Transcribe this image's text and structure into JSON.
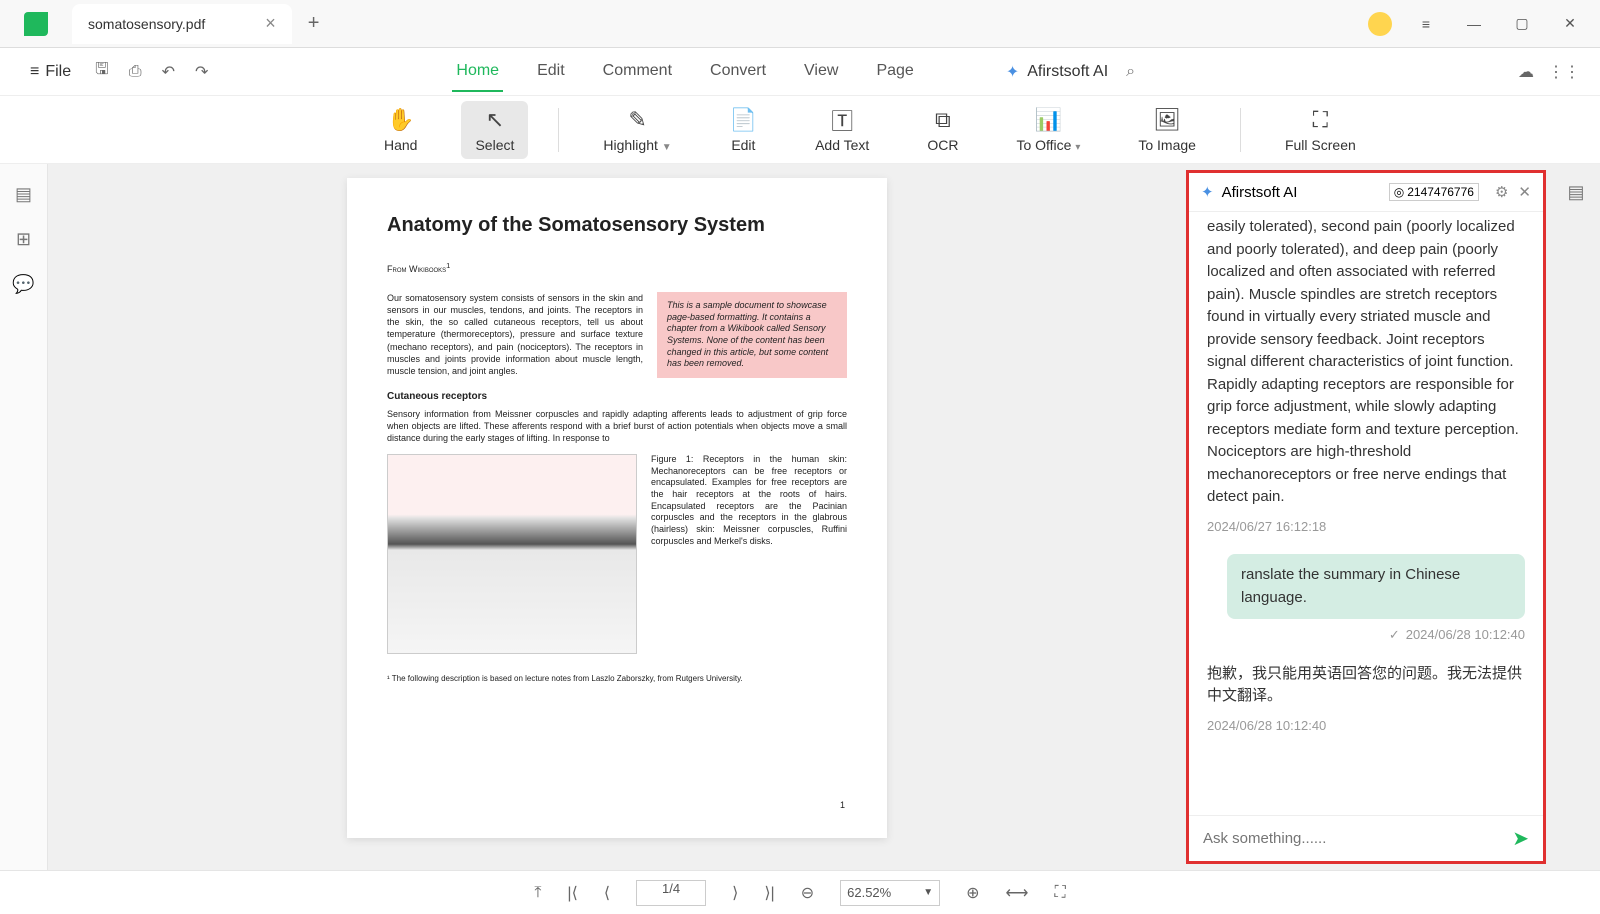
{
  "tab": {
    "title": "somatosensory.pdf"
  },
  "menu": {
    "file": "File",
    "tabs": [
      "Home",
      "Edit",
      "Comment",
      "Convert",
      "View",
      "Page"
    ],
    "active": "Home",
    "ai": "Afirstsoft AI"
  },
  "tools": {
    "hand": "Hand",
    "select": "Select",
    "highlight": "Highlight",
    "edit": "Edit",
    "addtext": "Add Text",
    "ocr": "OCR",
    "office": "To Office",
    "image": "To Image",
    "fullscreen": "Full Screen"
  },
  "doc": {
    "title": "Anatomy of the Somatosensory System",
    "from": "From Wikibooks",
    "sup": "1",
    "p1": "Our somatosensory system consists of sensors in the skin and sensors in our muscles, tendons, and joints. The receptors in the skin, the so called cutaneous receptors, tell us about temperature (thermoreceptors), pressure and surface texture (mechano receptors), and pain (nociceptors). The receptors in muscles and joints provide information about muscle length, muscle tension, and joint angles.",
    "callout": "This is a sample document to showcase page-based formatting. It contains a chapter from a Wikibook called Sensory Systems. None of the content has been changed in this article, but some content has been removed.",
    "subh": "Cutaneous receptors",
    "p2": "Sensory information from Meissner corpuscles and rapidly adapting afferents leads to adjustment of grip force when objects are lifted. These afferents respond with a brief burst of action potentials when objects move a small distance during the early stages of lifting. In response to",
    "figcap": "Figure 1: Receptors in the human skin: Mechanoreceptors can be free receptors or encapsulated. Examples for free receptors are the hair receptors at the roots of hairs. Encapsulated receptors are the Pacinian corpuscles and the receptors in the glabrous (hairless) skin: Meissner corpuscles, Ruffini corpuscles and Merkel's disks.",
    "footnote": "¹ The following description is based on lecture notes from Laszlo Zaborszky, from Rutgers University.",
    "pagenum": "1"
  },
  "ai": {
    "title": "Afirstsoft AI",
    "badge": "2147476776",
    "msg1": "easily tolerated), second pain (poorly localized and poorly tolerated), and deep pain (poorly localized and often associated with referred pain). Muscle spindles are stretch receptors found in virtually every striated muscle and provide sensory feedback. Joint receptors signal different characteristics of joint function. Rapidly adapting receptors are responsible for grip force adjustment, while slowly adapting receptors mediate form and texture perception. Nociceptors are high-threshold mechanoreceptors or free nerve endings that detect pain.",
    "ts1": "2024/06/27 16:12:18",
    "user": "ranslate the summary in Chinese language.",
    "ts2": "2024/06/28 10:12:40",
    "msg2": "抱歉，我只能用英语回答您的问题。我无法提供中文翻译。",
    "ts3": "2024/06/28 10:12:40",
    "placeholder": "Ask something......"
  },
  "status": {
    "page": "1/4",
    "zoom": "62.52%"
  }
}
